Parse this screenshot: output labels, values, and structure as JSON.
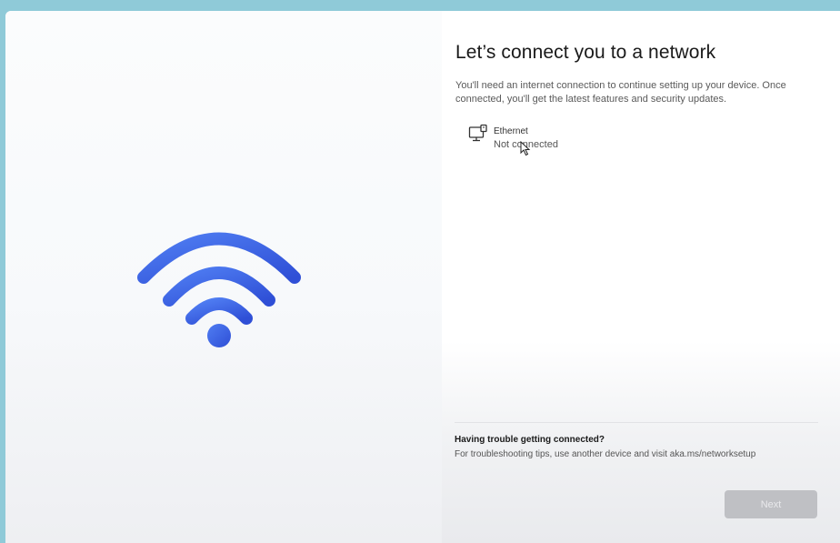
{
  "page": {
    "title": "Let’s connect you to a network",
    "subtitle": "You'll need an internet connection to continue setting up your device. Once connected, you'll get the latest features and security updates."
  },
  "network": {
    "name": "Ethernet",
    "status": "Not connected",
    "icon": "ethernet-icon"
  },
  "illustration": {
    "icon": "wifi-icon",
    "colors": [
      "#3b5bdb",
      "#4a7cf0",
      "#2d5ce0"
    ]
  },
  "help": {
    "title": "Having trouble getting connected?",
    "text": "For troubleshooting tips, use another device and visit aka.ms/networksetup"
  },
  "footer": {
    "next_label": "Next"
  },
  "colors": {
    "background": "#8fcad8",
    "accent": "#3b5bdb",
    "button_disabled": "#bfc0c4"
  }
}
